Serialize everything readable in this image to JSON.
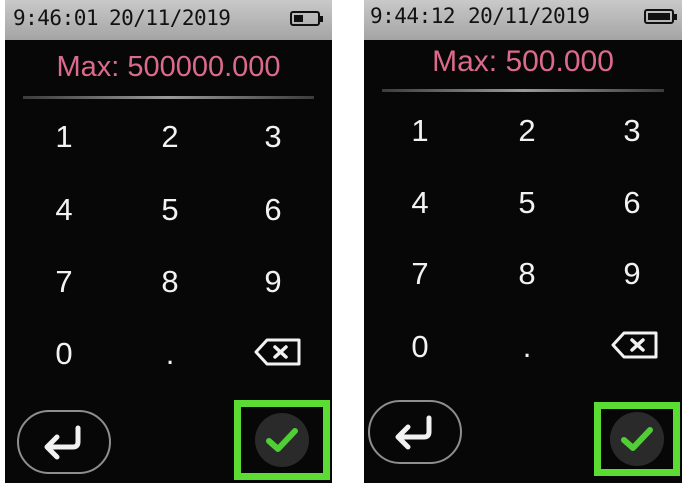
{
  "screens": [
    {
      "status_bar": {
        "time": "9:46:01",
        "date": "20/11/2019",
        "battery_icon": "battery-icon"
      },
      "input": {
        "value": "Max: 500000.000"
      },
      "keypad": {
        "keys": [
          "1",
          "2",
          "3",
          "4",
          "5",
          "6",
          "7",
          "8",
          "9",
          "0",
          "."
        ],
        "backspace_icon": "backspace-icon"
      },
      "actions": {
        "enter_icon": "enter-return-icon",
        "confirm_icon": "checkmark-icon"
      }
    },
    {
      "status_bar": {
        "time": "9:44:12",
        "date": "20/11/2019",
        "battery_icon": "battery-icon"
      },
      "input": {
        "value": "Max: 500.000"
      },
      "keypad": {
        "keys": [
          "1",
          "2",
          "3",
          "4",
          "5",
          "6",
          "7",
          "8",
          "9",
          "0",
          "."
        ],
        "backspace_icon": "backspace-icon"
      },
      "actions": {
        "enter_icon": "enter-return-icon",
        "confirm_icon": "checkmark-icon"
      }
    }
  ],
  "colors": {
    "input_text": "#dc6a8c",
    "highlight": "#5bdc33",
    "checkmark": "#4fcf35",
    "screen_bg": "#070707"
  }
}
